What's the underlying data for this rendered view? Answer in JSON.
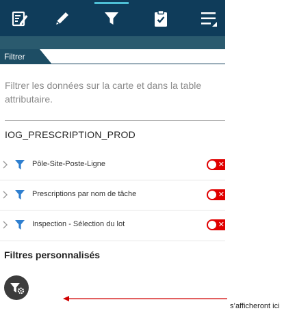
{
  "toolbar": {
    "tools": [
      {
        "icon": "edit-form-icon"
      },
      {
        "icon": "pencil-icon"
      },
      {
        "icon": "filter-icon",
        "active": true
      },
      {
        "icon": "clipboard-check-icon"
      },
      {
        "icon": "menu-icon"
      }
    ],
    "colors": {
      "bar": "#0f3c5a",
      "active_indicator": "#4ec0d6",
      "subbar": "#2a5a6e"
    }
  },
  "tab": {
    "label": "Filtrer"
  },
  "panel": {
    "description": "Filtrer les données sur la carte et dans la table attributaire.",
    "layer_title": "IOG_PRESCRIPTION_PROD",
    "filters": [
      {
        "label": "Pôle-Site-Poste-Ligne",
        "enabled": false
      },
      {
        "label": "Prescriptions par nom de tâche",
        "enabled": false
      },
      {
        "label": "Inspection - Sélection du lot",
        "enabled": false
      }
    ],
    "toggle_color": "#e00000",
    "custom_title": "Filtres personnalisés"
  },
  "annotation": {
    "note": "s’afficheront ici",
    "arrow_color": "#d00000"
  }
}
